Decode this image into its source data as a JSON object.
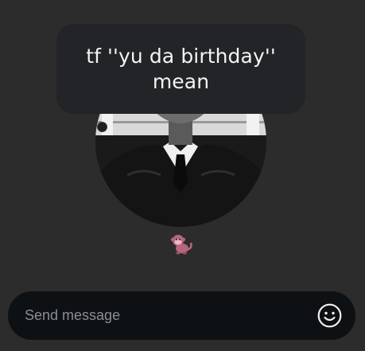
{
  "message": {
    "text": "tf ''yu da birthday'' mean"
  },
  "reaction": {
    "icon": "monkey-icon"
  },
  "composer": {
    "placeholder": "Send message",
    "value": "",
    "emoji_icon": "smiley-icon"
  },
  "colors": {
    "background": "#2c2c2c",
    "bubble": "#232427",
    "composer": "#0e1113",
    "text": "#f4f4f4",
    "placeholder": "#8b8d90"
  }
}
